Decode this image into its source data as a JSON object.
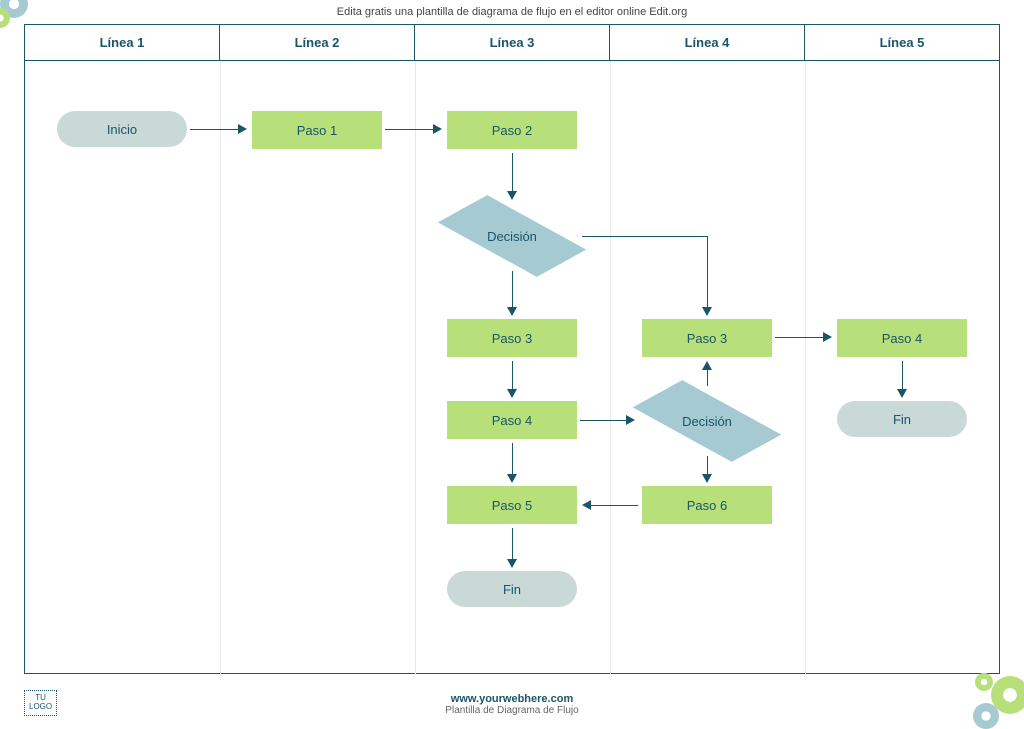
{
  "tagline": "Edita gratis una plantilla de diagrama de flujo en el editor online Edit.org",
  "lanes": [
    "Línea 1",
    "Línea 2",
    "Línea 3",
    "Línea 4",
    "Línea 5"
  ],
  "nodes": {
    "inicio": "Inicio",
    "paso1": "Paso 1",
    "paso2": "Paso 2",
    "decision1": "Decisión",
    "paso3a": "Paso 3",
    "paso3b": "Paso 3",
    "paso4a": "Paso 4",
    "paso4b": "Paso 4",
    "decision2": "Decisión",
    "paso5": "Paso 5",
    "paso6": "Paso 6",
    "fin1": "Fin",
    "fin2": "Fin"
  },
  "footer": {
    "web": "www.yourwebhere.com",
    "sub": "Plantilla de Diagrama de Flujo"
  },
  "logo": "TU\nLOGO",
  "chart_data": {
    "type": "flowchart-swimlane",
    "lanes": [
      "Línea 1",
      "Línea 2",
      "Línea 3",
      "Línea 4",
      "Línea 5"
    ],
    "nodes": [
      {
        "id": "inicio",
        "type": "terminator",
        "label": "Inicio",
        "lane": 0
      },
      {
        "id": "paso1",
        "type": "process",
        "label": "Paso 1",
        "lane": 1
      },
      {
        "id": "paso2",
        "type": "process",
        "label": "Paso 2",
        "lane": 2
      },
      {
        "id": "decision1",
        "type": "decision",
        "label": "Decisión",
        "lane": 2
      },
      {
        "id": "paso3a",
        "type": "process",
        "label": "Paso 3",
        "lane": 2
      },
      {
        "id": "paso3b",
        "type": "process",
        "label": "Paso 3",
        "lane": 3
      },
      {
        "id": "paso4b",
        "type": "process",
        "label": "Paso 4",
        "lane": 4
      },
      {
        "id": "paso4a",
        "type": "process",
        "label": "Paso 4",
        "lane": 2
      },
      {
        "id": "decision2",
        "type": "decision",
        "label": "Decisión",
        "lane": 3
      },
      {
        "id": "fin2",
        "type": "terminator",
        "label": "Fin",
        "lane": 4
      },
      {
        "id": "paso5",
        "type": "process",
        "label": "Paso 5",
        "lane": 2
      },
      {
        "id": "paso6",
        "type": "process",
        "label": "Paso 6",
        "lane": 3
      },
      {
        "id": "fin1",
        "type": "terminator",
        "label": "Fin",
        "lane": 2
      }
    ],
    "edges": [
      {
        "from": "inicio",
        "to": "paso1"
      },
      {
        "from": "paso1",
        "to": "paso2"
      },
      {
        "from": "paso2",
        "to": "decision1"
      },
      {
        "from": "decision1",
        "to": "paso3a"
      },
      {
        "from": "decision1",
        "to": "paso3b"
      },
      {
        "from": "paso3b",
        "to": "paso4b"
      },
      {
        "from": "paso3a",
        "to": "paso4a"
      },
      {
        "from": "paso4b",
        "to": "fin2"
      },
      {
        "from": "paso4a",
        "to": "decision2"
      },
      {
        "from": "paso4a",
        "to": "paso5"
      },
      {
        "from": "decision2",
        "to": "paso3b"
      },
      {
        "from": "decision2",
        "to": "paso6"
      },
      {
        "from": "paso6",
        "to": "paso5"
      },
      {
        "from": "paso5",
        "to": "fin1"
      }
    ]
  }
}
